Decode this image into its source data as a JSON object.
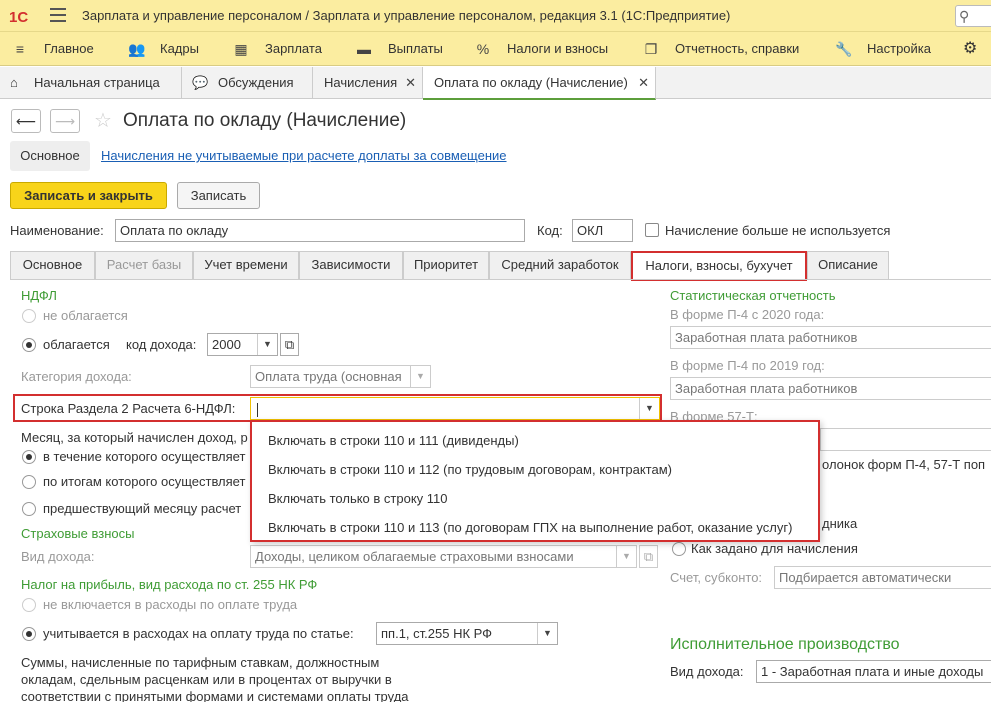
{
  "app": {
    "title": "Зарплата и управление персоналом / Зарплата и управление персоналом, редакция 3.1  (1С:Предприятие)",
    "logo_text": "1С",
    "search_icon": "search-icon"
  },
  "menu": [
    {
      "label": "Главное",
      "icon": "burger-icon"
    },
    {
      "label": "Кадры",
      "icon": "people-icon"
    },
    {
      "label": "Зарплата",
      "icon": "calculator-icon"
    },
    {
      "label": "Выплаты",
      "icon": "wallet-icon"
    },
    {
      "label": "Налоги и взносы",
      "icon": "percent-icon"
    },
    {
      "label": "Отчетность, справки",
      "icon": "documents-icon"
    },
    {
      "label": "Настройка",
      "icon": "wrench-icon"
    }
  ],
  "tabs": [
    {
      "label": "Начальная страница"
    },
    {
      "label": "Обсуждения"
    },
    {
      "label": "Начисления"
    },
    {
      "label": "Оплата по окладу (Начисление)"
    }
  ],
  "form": {
    "title": "Оплата по окладу (Начисление)",
    "subtab_main": "Основное",
    "sublink": "Начисления не учитываемые при расчете доплаты за совмещение",
    "save_close": "Записать и закрыть",
    "save": "Записать",
    "name_label": "Наименование:",
    "name_value": "Оплата по окладу",
    "code_label": "Код:",
    "code_value": "ОКЛ",
    "unused_label": "Начисление больше не используется"
  },
  "form_tabs": [
    "Основное",
    "Расчет базы",
    "Учет времени",
    "Зависимости",
    "Приоритет",
    "Средний заработок",
    "Налоги, взносы, бухучет",
    "Описание"
  ],
  "ndfl": {
    "heading": "НДФЛ",
    "not_taxed": "не облагается",
    "taxed": "облагается",
    "income_code_label": "код дохода:",
    "income_code": "2000",
    "category_label": "Категория дохода:",
    "category_value": "Оплата труда (основная",
    "line_label": "Строка Раздела 2 Расчета 6-НДФЛ:",
    "line_value": "",
    "month_label": "Месяц, за который начислен доход, р",
    "month_opt1": "в течение которого осуществляет",
    "month_opt2": "по итогам которого осуществляет",
    "month_opt3": "предшествующий месяцу расчет"
  },
  "dropdown_options": [
    "Включать в строки 110 и 111 (дивиденды)",
    "Включать в строки 110 и 112 (по трудовым договорам, контрактам)",
    "Включать только в строку 110",
    "Включать в строки 110 и 113 (по договорам ГПХ на выполнение работ, оказание услуг)"
  ],
  "insurance": {
    "heading": "Страховые взносы",
    "income_type_label": "Вид дохода:",
    "income_type_value": "Доходы, целиком облагаемые страховыми взносами"
  },
  "profit_tax": {
    "heading": "Налог на прибыль, вид расхода по ст. 255 НК РФ",
    "opt_not_included": "не включается в расходы по оплате труда",
    "opt_included": "учитывается в расходах на оплату труда по статье:",
    "article_value": "пп.1, ст.255 НК РФ",
    "note": "Суммы, начисленные по тарифным ставкам, должностным окладам, сдельным расценкам или в процентах от выручки в соответствии с принятыми формами и системами оплаты труда"
  },
  "stats": {
    "heading": "Статистическая отчетность",
    "p4_2020_label": "В форме П-4 с 2020 года:",
    "p4_2020_value": "Заработная плата работников",
    "p4_2019_label": "В форме П-4 по 2019 год:",
    "p4_2019_value": "Заработная плата работников",
    "f57t_label": "В форме 57-Т:",
    "columns_text": "олонок форм П-4, 57-Т поп",
    "employee_text": "дника",
    "as_defined": "Как задано для начисления",
    "account_label": "Счет, субконто:",
    "account_value": "Подбирается автоматически"
  },
  "enforcement": {
    "heading": "Исполнительное производство",
    "income_type_label": "Вид дохода:",
    "income_type_value": "1 - Заработная плата и иные доходы"
  }
}
